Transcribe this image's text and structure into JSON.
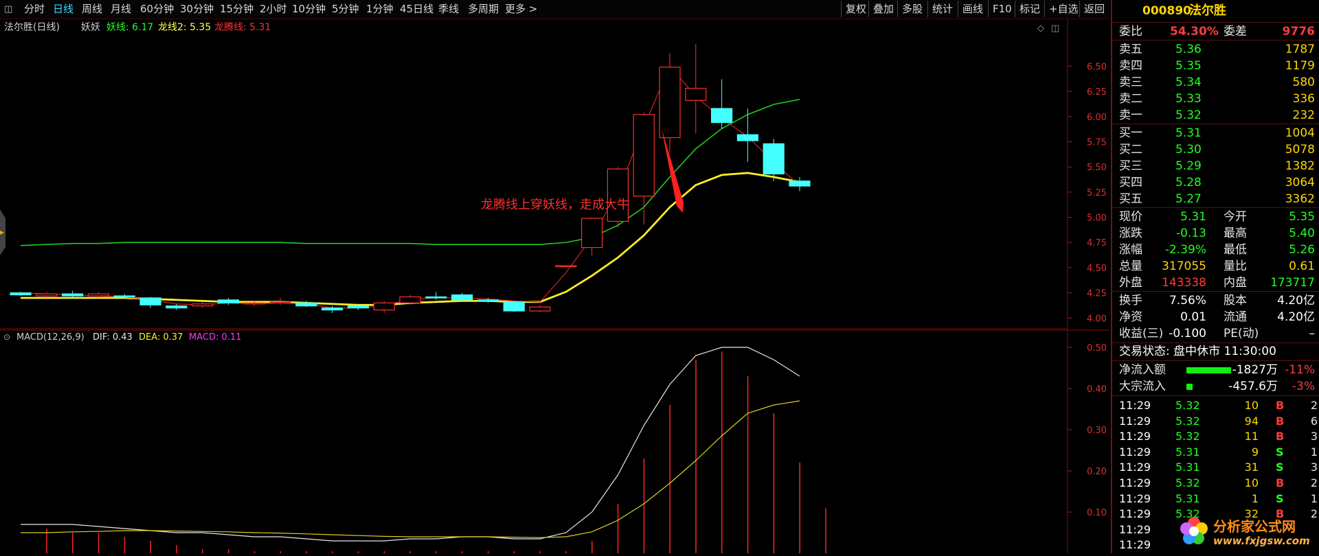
{
  "toolbar": {
    "periods": [
      "分时",
      "日线",
      "周线",
      "月线",
      "60分钟",
      "30分钟",
      "15分钟",
      "2小时",
      "10分钟",
      "5分钟",
      "1分钟",
      "45日线",
      "季线",
      "多周期",
      "更多 >"
    ],
    "active_period": "日线",
    "actions": [
      "复权",
      "叠加",
      "多股",
      "统计",
      "画线",
      "F10",
      "标记",
      "+自选",
      "返回"
    ]
  },
  "indicator_header": {
    "stock_label": "法尔胜(日线)",
    "indicator_name": "妖妖",
    "line1": "妖线: 6.17",
    "line2": "龙线2: 5.35",
    "line3": "龙腾线: 5.31"
  },
  "annotation": "龙腾线上穿妖线，走成大牛",
  "macd_header": {
    "label": "MACD(12,26,9)",
    "dif": "DIF: 0.43",
    "dea": "DEA: 0.37",
    "macd": "MACD: 0.11"
  },
  "price_axis": [
    "6.50",
    "6.25",
    "6.00",
    "5.75",
    "5.50",
    "5.25",
    "5.00",
    "4.75",
    "4.50",
    "4.25",
    "4.00"
  ],
  "macd_axis": [
    "0.50",
    "0.40",
    "0.30",
    "0.20",
    "0.10"
  ],
  "chart_data": {
    "type": "candlestick",
    "ylim": [
      3.9,
      6.85
    ],
    "candles": [
      {
        "o": 4.25,
        "c": 4.23,
        "h": 4.26,
        "l": 4.22
      },
      {
        "o": 4.22,
        "c": 4.24,
        "h": 4.26,
        "l": 4.2
      },
      {
        "o": 4.24,
        "c": 4.22,
        "h": 4.27,
        "l": 4.21
      },
      {
        "o": 4.22,
        "c": 4.24,
        "h": 4.26,
        "l": 4.2
      },
      {
        "o": 4.22,
        "c": 4.21,
        "h": 4.24,
        "l": 4.2
      },
      {
        "o": 4.2,
        "c": 4.13,
        "h": 4.21,
        "l": 4.1
      },
      {
        "o": 4.12,
        "c": 4.1,
        "h": 4.14,
        "l": 4.08
      },
      {
        "o": 4.12,
        "c": 4.14,
        "h": 4.16,
        "l": 4.1
      },
      {
        "o": 4.18,
        "c": 4.15,
        "h": 4.2,
        "l": 4.13
      },
      {
        "o": 4.14,
        "c": 4.15,
        "h": 4.17,
        "l": 4.12
      },
      {
        "o": 4.15,
        "c": 4.16,
        "h": 4.2,
        "l": 4.13
      },
      {
        "o": 4.15,
        "c": 4.12,
        "h": 4.17,
        "l": 4.11
      },
      {
        "o": 4.1,
        "c": 4.08,
        "h": 4.12,
        "l": 4.05
      },
      {
        "o": 4.12,
        "c": 4.1,
        "h": 4.14,
        "l": 4.08
      },
      {
        "o": 4.08,
        "c": 4.15,
        "h": 4.17,
        "l": 4.05
      },
      {
        "o": 4.15,
        "c": 4.21,
        "h": 4.23,
        "l": 4.13
      },
      {
        "o": 4.21,
        "c": 4.2,
        "h": 4.26,
        "l": 4.18
      },
      {
        "o": 4.23,
        "c": 4.18,
        "h": 4.25,
        "l": 4.17
      },
      {
        "o": 4.18,
        "c": 4.17,
        "h": 4.2,
        "l": 4.15
      },
      {
        "o": 4.16,
        "c": 4.07,
        "h": 4.17,
        "l": 4.06
      },
      {
        "o": 4.07,
        "c": 4.11,
        "h": 4.13,
        "l": 4.06
      },
      {
        "o": 4.52,
        "c": 4.52,
        "h": 4.52,
        "l": 4.52
      },
      {
        "o": 4.7,
        "c": 4.99,
        "h": 5.0,
        "l": 4.62
      },
      {
        "o": 4.96,
        "c": 5.48,
        "h": 5.5,
        "l": 4.9
      },
      {
        "o": 5.21,
        "c": 6.02,
        "h": 6.04,
        "l": 4.93
      },
      {
        "o": 5.79,
        "c": 6.49,
        "h": 6.63,
        "l": 5.64
      },
      {
        "o": 6.16,
        "c": 6.28,
        "h": 6.72,
        "l": 5.83
      },
      {
        "o": 6.08,
        "c": 5.94,
        "h": 6.37,
        "l": 5.88
      },
      {
        "o": 5.82,
        "c": 5.76,
        "h": 6.08,
        "l": 5.55
      },
      {
        "o": 5.73,
        "c": 5.43,
        "h": 5.78,
        "l": 5.36
      },
      {
        "o": 5.36,
        "c": 5.31,
        "h": 5.4,
        "l": 5.26
      }
    ],
    "x_start": 30,
    "x_step": 37.8,
    "yao_line": [
      4.72,
      4.73,
      4.74,
      4.74,
      4.75,
      4.75,
      4.75,
      4.75,
      4.75,
      4.75,
      4.75,
      4.74,
      4.74,
      4.74,
      4.74,
      4.74,
      4.73,
      4.73,
      4.73,
      4.73,
      4.73,
      4.75,
      4.8,
      4.92,
      5.1,
      5.4,
      5.68,
      5.88,
      6.02,
      6.12,
      6.17
    ],
    "long2_line": [
      4.2,
      4.2,
      4.2,
      4.2,
      4.2,
      4.19,
      4.18,
      4.17,
      4.16,
      4.16,
      4.16,
      4.15,
      4.14,
      4.13,
      4.13,
      4.15,
      4.16,
      4.17,
      4.17,
      4.16,
      4.16,
      4.26,
      4.42,
      4.6,
      4.82,
      5.1,
      5.32,
      5.42,
      5.44,
      5.4,
      5.35
    ],
    "longteng_line": [
      4.25,
      4.24,
      4.23,
      4.22,
      4.21,
      4.18,
      4.14,
      4.13,
      4.15,
      4.14,
      4.15,
      4.14,
      4.1,
      4.1,
      4.12,
      4.19,
      4.2,
      4.2,
      4.19,
      4.17,
      4.16,
      4.45,
      4.8,
      5.25,
      5.9,
      6.5,
      6.2,
      5.98,
      5.8,
      5.55,
      5.31
    ],
    "macd_ylim": [
      0.0,
      0.54
    ],
    "dif": [
      0.07,
      0.07,
      0.07,
      0.065,
      0.06,
      0.055,
      0.05,
      0.05,
      0.045,
      0.04,
      0.04,
      0.035,
      0.03,
      0.03,
      0.03,
      0.035,
      0.035,
      0.04,
      0.04,
      0.035,
      0.035,
      0.05,
      0.1,
      0.19,
      0.31,
      0.41,
      0.48,
      0.5,
      0.5,
      0.47,
      0.43
    ],
    "dea": [
      0.05,
      0.05,
      0.052,
      0.053,
      0.055,
      0.055,
      0.054,
      0.053,
      0.052,
      0.05,
      0.049,
      0.047,
      0.045,
      0.043,
      0.041,
      0.04,
      0.04,
      0.04,
      0.04,
      0.039,
      0.038,
      0.04,
      0.052,
      0.08,
      0.12,
      0.17,
      0.225,
      0.285,
      0.34,
      0.36,
      0.37
    ],
    "macd_bars": [
      0.06,
      0.05,
      0.05,
      0.04,
      0.03,
      0.02,
      0.01,
      0.01,
      0.005,
      0.005,
      0.005,
      0.005,
      0.005,
      0.005,
      0.005,
      0.005,
      0.005,
      0.005,
      0.005,
      0.005,
      0.005,
      0.03,
      0.12,
      0.23,
      0.36,
      0.47,
      0.49,
      0.43,
      0.34,
      0.22,
      0.11
    ]
  },
  "panel": {
    "code": "000890",
    "name": "法尔胜",
    "weibi_label": "委比",
    "weibi_value": "54.30%",
    "weicha_label": "委差",
    "weicha_value": "9776",
    "asks": [
      {
        "label": "卖五",
        "price": "5.36",
        "vol": "1787"
      },
      {
        "label": "卖四",
        "price": "5.35",
        "vol": "1179"
      },
      {
        "label": "卖三",
        "price": "5.34",
        "vol": "580"
      },
      {
        "label": "卖二",
        "price": "5.33",
        "vol": "336"
      },
      {
        "label": "卖一",
        "price": "5.32",
        "vol": "232"
      }
    ],
    "bids": [
      {
        "label": "买一",
        "price": "5.31",
        "vol": "1004"
      },
      {
        "label": "买二",
        "price": "5.30",
        "vol": "5078"
      },
      {
        "label": "买三",
        "price": "5.29",
        "vol": "1382"
      },
      {
        "label": "买四",
        "price": "5.28",
        "vol": "3064"
      },
      {
        "label": "买五",
        "price": "5.27",
        "vol": "3362"
      }
    ],
    "quote": [
      {
        "l1": "现价",
        "v1": "5.31",
        "c1": "grn",
        "l2": "今开",
        "v2": "5.35",
        "c2": "grn"
      },
      {
        "l1": "涨跌",
        "v1": "-0.13",
        "c1": "grn",
        "l2": "最高",
        "v2": "5.40",
        "c2": "grn"
      },
      {
        "l1": "涨幅",
        "v1": "-2.39%",
        "c1": "grn",
        "l2": "最低",
        "v2": "5.26",
        "c2": "grn"
      },
      {
        "l1": "总量",
        "v1": "317055",
        "c1": "yel",
        "l2": "量比",
        "v2": "0.61",
        "c2": "yel"
      },
      {
        "l1": "外盘",
        "v1": "143338",
        "c1": "red",
        "l2": "内盘",
        "v2": "173717",
        "c2": "grn"
      }
    ],
    "fund": [
      {
        "l1": "换手",
        "v1": "7.56%",
        "l2": "股本",
        "v2": "4.20亿"
      },
      {
        "l1": "净资",
        "v1": "0.01",
        "l2": "流通",
        "v2": "4.20亿"
      },
      {
        "l1": "收益(三)",
        "v1": "-0.100",
        "l2": "PE(动)",
        "v2": "–"
      }
    ],
    "status": "交易状态: 盘中休市 11:30:00",
    "flow": [
      {
        "label": "净流入额",
        "value": "-1827万",
        "pct": "-11%",
        "bar": 0.85
      },
      {
        "label": "大宗流入",
        "value": "-457.6万",
        "pct": "-3%",
        "bar": 0.12
      }
    ],
    "trades": [
      {
        "time": "11:29",
        "price": "5.32",
        "vol": "10",
        "bs": "B",
        "n": "2"
      },
      {
        "time": "11:29",
        "price": "5.32",
        "vol": "94",
        "bs": "B",
        "n": "6"
      },
      {
        "time": "11:29",
        "price": "5.32",
        "vol": "11",
        "bs": "B",
        "n": "3"
      },
      {
        "time": "11:29",
        "price": "5.31",
        "vol": "9",
        "bs": "S",
        "n": "1"
      },
      {
        "time": "11:29",
        "price": "5.31",
        "vol": "31",
        "bs": "S",
        "n": "3"
      },
      {
        "time": "11:29",
        "price": "5.32",
        "vol": "10",
        "bs": "B",
        "n": "2"
      },
      {
        "time": "11:29",
        "price": "5.31",
        "vol": "1",
        "bs": "S",
        "n": "1"
      },
      {
        "time": "11:29",
        "price": "5.32",
        "vol": "32",
        "bs": "B",
        "n": "2"
      },
      {
        "time": "11:29",
        "price": "",
        "vol": "",
        "bs": "",
        "n": ""
      },
      {
        "time": "11:29",
        "price": "",
        "vol": "",
        "bs": "",
        "n": ""
      }
    ],
    "watermark_cn": "分析家公式网",
    "watermark_url": "www.fxjgsw.com"
  }
}
